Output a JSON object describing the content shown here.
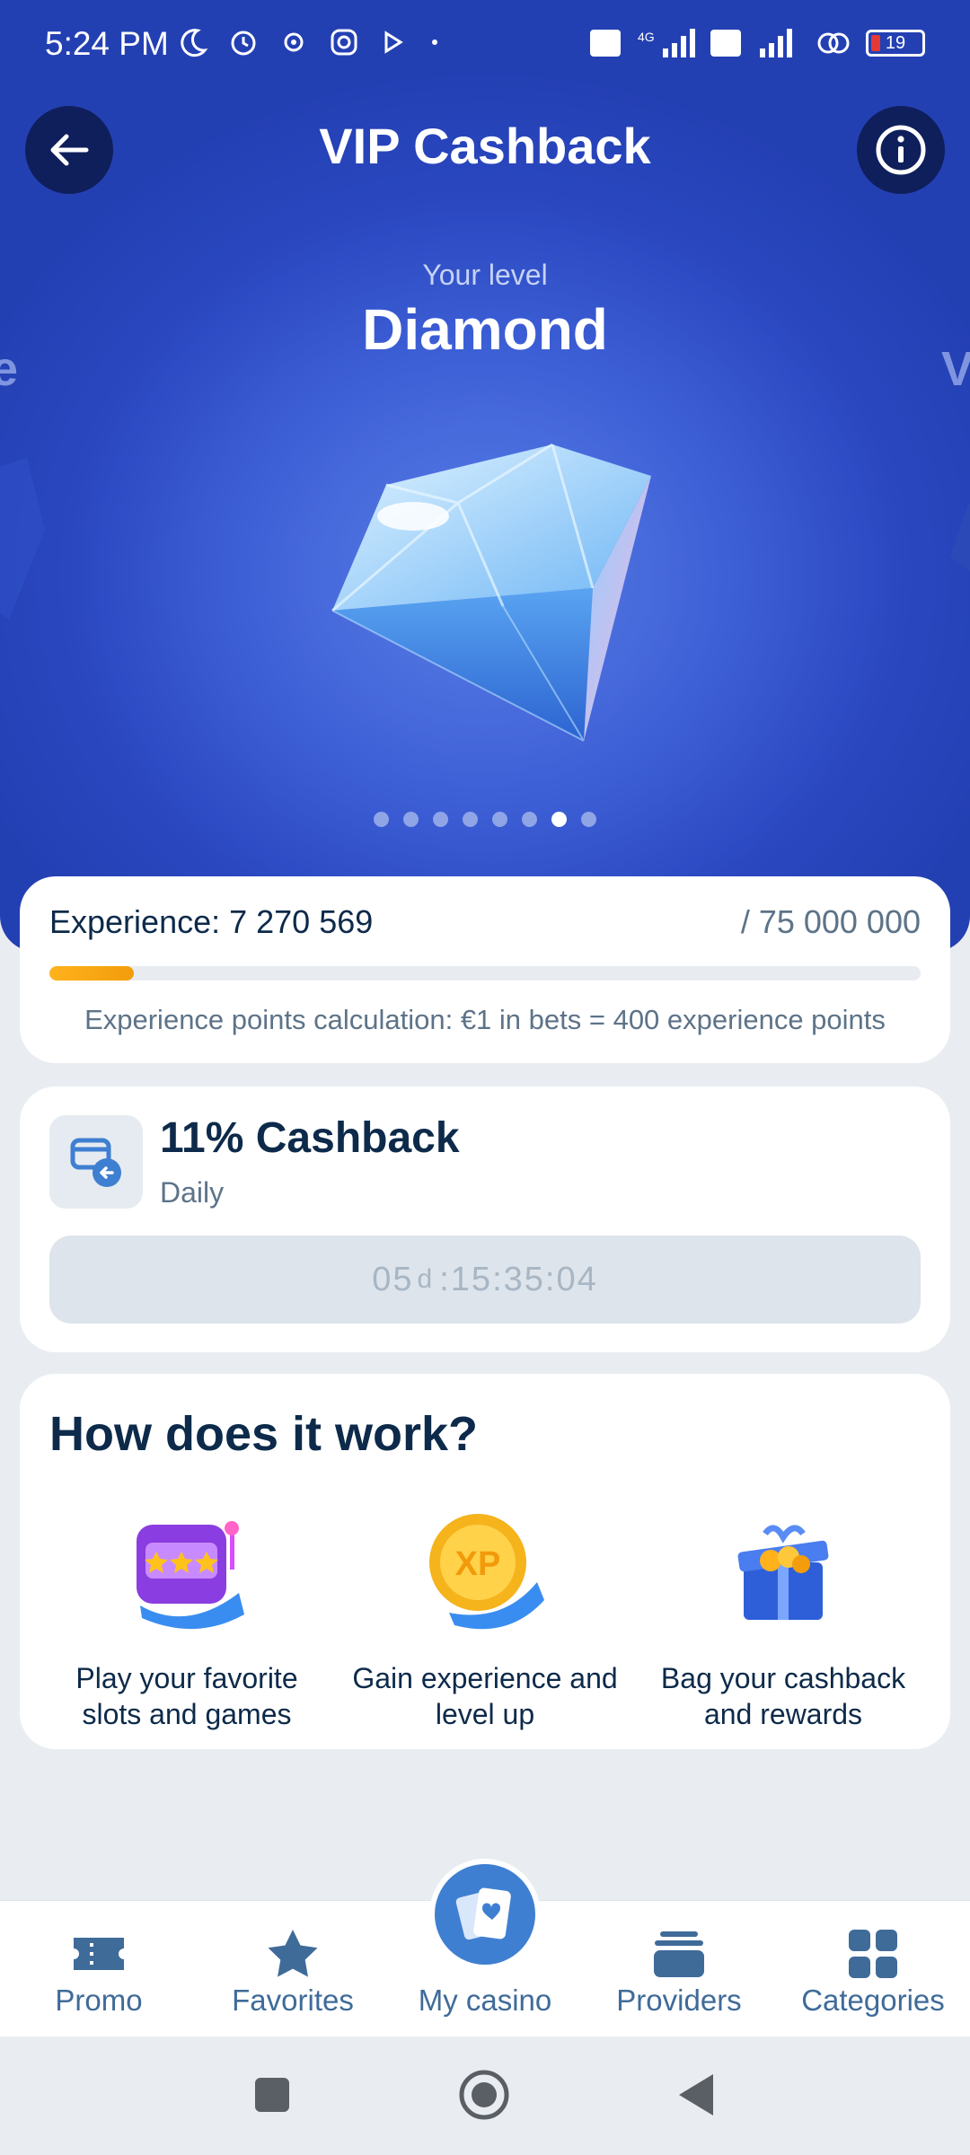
{
  "status_bar": {
    "time": "5:24 PM",
    "battery": "19",
    "network": "4G",
    "volte": "Vo LTE"
  },
  "header": {
    "title": "VIP Cashback",
    "back_icon": "arrow-left-icon",
    "info_icon": "info-icon"
  },
  "level": {
    "label": "Your level",
    "name": "Diamond",
    "left_peek": "e",
    "right_peek": "V",
    "carousel_count": 8,
    "carousel_active_index": 6
  },
  "experience": {
    "label": "Experience: 7 270 569",
    "total": "/ 75 000 000",
    "progress_fraction": 0.097,
    "note": "Experience points calculation: €1 in bets = 400 experience points"
  },
  "cashback": {
    "title": "11% Cashback",
    "subtitle": "Daily",
    "timer": {
      "days": "05",
      "days_unit": "d",
      "hours": "15",
      "minutes": "35",
      "seconds": "04",
      "sep": ":"
    }
  },
  "how_it_works": {
    "title": "How does it work?",
    "steps": [
      {
        "caption_line1": "Play your favorite",
        "caption_line2": "slots and games"
      },
      {
        "caption_line1": "Gain experience and",
        "caption_line2": "level up"
      },
      {
        "caption_line1": "Bag your cashback",
        "caption_line2": "and rewards"
      }
    ],
    "xp_badge": "XP"
  },
  "bottom_nav": {
    "items": [
      {
        "label": "Promo",
        "icon": "ticket-icon"
      },
      {
        "label": "Favorites",
        "icon": "star-icon"
      },
      {
        "label": "My casino",
        "icon": "cards-icon"
      },
      {
        "label": "Providers",
        "icon": "stack-icon"
      },
      {
        "label": "Categories",
        "icon": "grid-icon"
      }
    ]
  },
  "colors": {
    "hero_blue": "#3d5fd6",
    "dark_navy": "#0d2a4a",
    "accent_orange": "#f5a313",
    "nav_blue": "#3f6b99"
  }
}
